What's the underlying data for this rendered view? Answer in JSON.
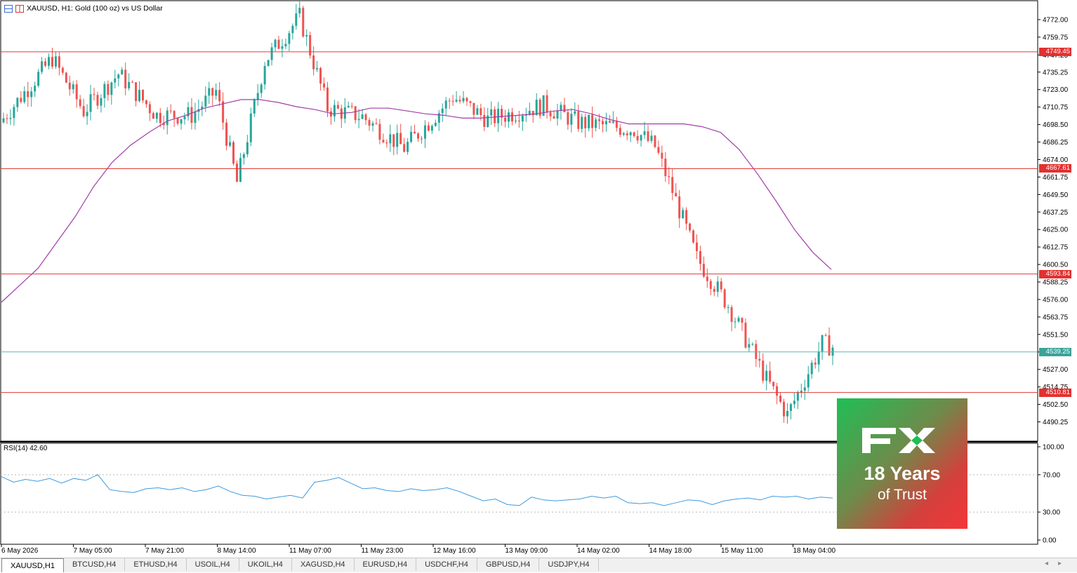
{
  "window": {
    "title": "XAUUSD, H1:  Gold (100 oz) vs US Dollar",
    "rsi_title": "RSI(14) 42.60"
  },
  "colors": {
    "bull": "#26a69a",
    "bear": "#ef5350",
    "level_line": "#e03a3a",
    "current_line": "#5fb7b0",
    "ma_line": "#a23ea8",
    "rsi_line": "#3d9ae0"
  },
  "price_axis": {
    "min": 4477.25,
    "max": 4784.75,
    "ticks": [
      "4772.00",
      "4759.75",
      "4747.25",
      "4735.25",
      "4723.00",
      "4710.75",
      "4698.50",
      "4686.25",
      "4674.00",
      "4661.75",
      "4649.50",
      "4637.25",
      "4625.00",
      "4612.75",
      "4600.50",
      "4588.25",
      "4576.00",
      "4563.75",
      "4551.50",
      "4539.25",
      "4527.00",
      "4514.75",
      "4502.50",
      "4490.25"
    ]
  },
  "levels": [
    {
      "label": "4749.45",
      "price": 4749.45,
      "kind": "resistance"
    },
    {
      "label": "4667.61",
      "price": 4667.61,
      "kind": "resistance"
    },
    {
      "label": "4593.84",
      "price": 4593.84,
      "kind": "support"
    },
    {
      "label": "4539.25",
      "price": 4539.25,
      "kind": "current"
    },
    {
      "label": "4510.81",
      "price": 4510.81,
      "kind": "support"
    }
  ],
  "rsi_axis": {
    "ticks": [
      "100.00",
      "70.00",
      "30.00",
      "0.00"
    ],
    "dashed_levels": [
      70,
      30
    ]
  },
  "time_axis": {
    "labels": [
      "6 May 2026",
      "7 May 05:00",
      "7 May 21:00",
      "8 May 14:00",
      "11 May 07:00",
      "11 May 23:00",
      "12 May 16:00",
      "13 May 09:00",
      "14 May 02:00",
      "14 May 18:00",
      "15 May 11:00",
      "18 May 04:00"
    ]
  },
  "tabs": [
    {
      "label": "XAUUSD,H1",
      "active": true
    },
    {
      "label": "BTCUSD,H4",
      "active": false
    },
    {
      "label": "ETHUSD,H4",
      "active": false
    },
    {
      "label": "USOIL,H4",
      "active": false
    },
    {
      "label": "UKOIL,H4",
      "active": false
    },
    {
      "label": "XAGUSD,H4",
      "active": false
    },
    {
      "label": "EURUSD,H4",
      "active": false
    },
    {
      "label": "USDCHF,H4",
      "active": false
    },
    {
      "label": "GBPUSD,H4",
      "active": false
    },
    {
      "label": "USDJPY,H4",
      "active": false
    }
  ],
  "badge": {
    "logo_text": "FX",
    "years": "18 Years",
    "trust": "of Trust"
  },
  "chart_data": {
    "type": "candlestick",
    "symbol": "XAUUSD",
    "timeframe": "H1",
    "ma_series": [
      4574,
      4586,
      4598,
      4616,
      4634,
      4655,
      4672,
      4684,
      4693,
      4701,
      4705,
      4710,
      4713,
      4716,
      4716,
      4714,
      4711,
      4709,
      4706,
      4707,
      4710,
      4710,
      4708,
      4706,
      4705,
      4703,
      4703,
      4704,
      4705,
      4706,
      4708,
      4709,
      4706,
      4702,
      4699,
      4699,
      4699,
      4699,
      4697,
      4693,
      4681,
      4664,
      4645,
      4625,
      4609,
      4597
    ],
    "rsi_series": [
      68,
      62,
      65,
      63,
      66,
      61,
      66,
      64,
      70,
      54,
      52,
      51,
      55,
      56,
      54,
      56,
      52,
      54,
      58,
      52,
      48,
      47,
      44,
      46,
      48,
      45,
      62,
      64,
      67,
      61,
      55,
      56,
      53,
      52,
      55,
      53,
      54,
      56,
      52,
      47,
      42,
      44,
      38,
      37,
      46,
      43,
      42,
      43,
      44,
      47,
      45,
      47,
      40,
      39,
      40,
      37,
      40,
      43,
      42,
      38,
      42,
      44,
      45,
      43,
      47,
      46,
      47,
      44,
      46,
      45
    ]
  }
}
